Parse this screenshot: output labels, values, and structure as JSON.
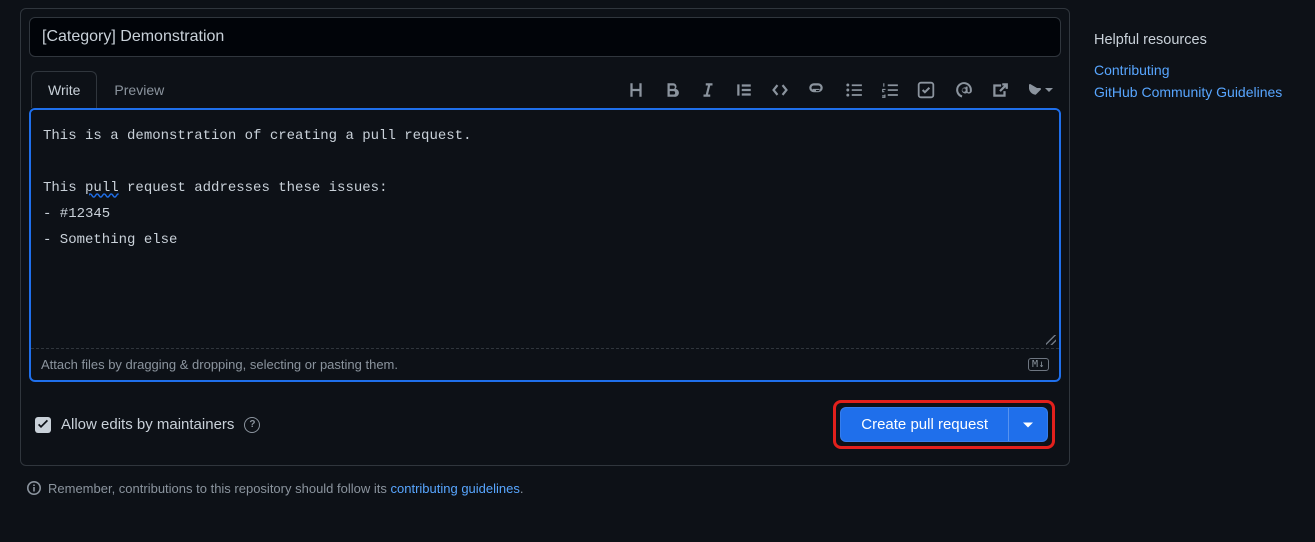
{
  "title": "[Category] Demonstration",
  "tabs": {
    "write": "Write",
    "preview": "Preview"
  },
  "body": {
    "line1": "This is a demonstration of creating a pull request.",
    "line2_pre": "This ",
    "line2_word": "pull",
    "line2_post": " request addresses these issues:",
    "line3": "- #12345",
    "line4": "- Something else"
  },
  "attach_hint": "Attach files by dragging & dropping, selecting or pasting them.",
  "md_badge": "M↓",
  "allow_edits_label": "Allow edits by maintainers",
  "create_label": "Create pull request",
  "footer_pre": "Remember, contributions to this repository should follow its ",
  "footer_link": "contributing guidelines",
  "footer_post": ".",
  "sidebar": {
    "title": "Helpful resources",
    "links": {
      "contributing": "Contributing",
      "guidelines": "GitHub Community Guidelines"
    }
  }
}
